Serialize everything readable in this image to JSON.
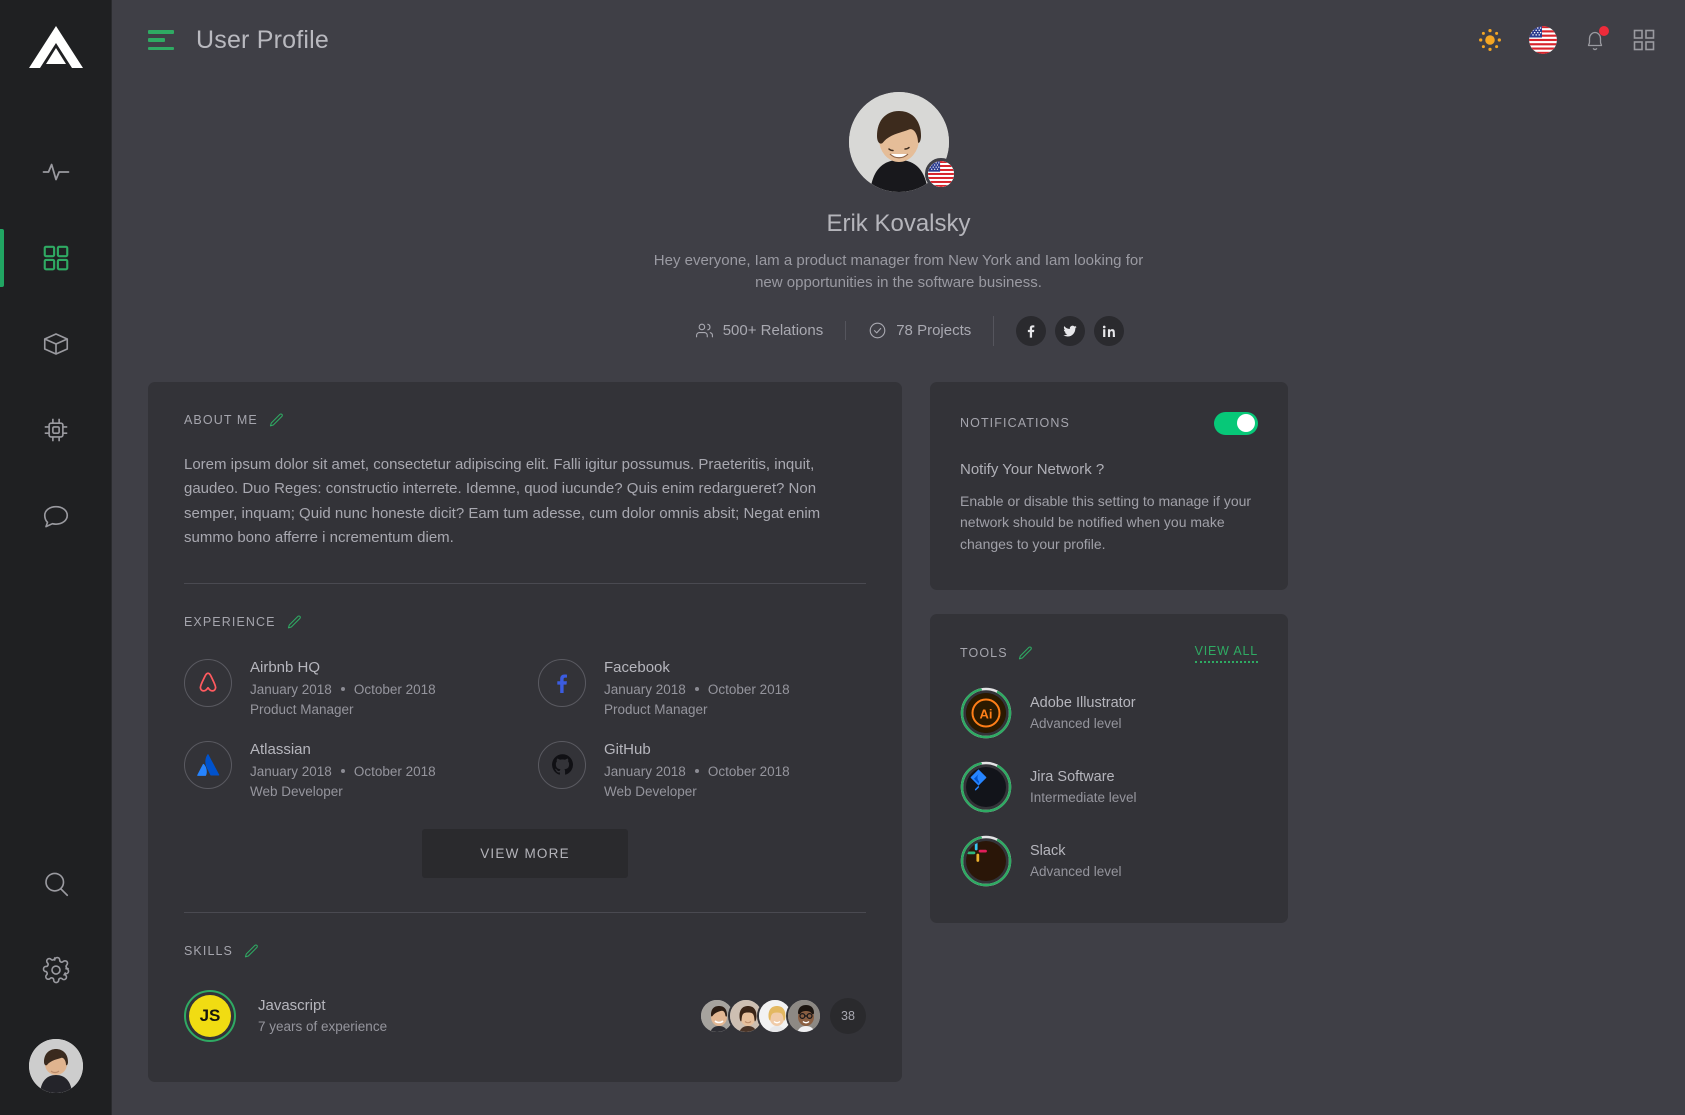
{
  "colors": {
    "accent_green": "#2faa63",
    "toggle_green": "#07c878",
    "page_bg": "#3f3f46",
    "card_bg": "#333338",
    "sidebar_bg": "#1f2022",
    "notif_dot_red": "#ee2b3a",
    "sun_orange": "#f5a623",
    "js_yellow": "#f1dc12"
  },
  "sidebar": {
    "logo_name": "triangle-logo",
    "items": [
      {
        "icon": "activity-icon",
        "name": "sidebar-item-activity",
        "active": false
      },
      {
        "icon": "grid-icon",
        "name": "sidebar-item-dashboard",
        "active": true
      },
      {
        "icon": "box-icon",
        "name": "sidebar-item-packages",
        "active": false
      },
      {
        "icon": "chip-icon",
        "name": "sidebar-item-components",
        "active": false
      },
      {
        "icon": "chat-icon",
        "name": "sidebar-item-messages",
        "active": false
      }
    ],
    "bottom_items": [
      {
        "icon": "search-icon",
        "name": "sidebar-item-search"
      },
      {
        "icon": "gear-icon",
        "name": "sidebar-item-settings"
      }
    ],
    "avatar_name": "sidebar-user-avatar"
  },
  "topbar": {
    "menu_icon": "hamburger-icon",
    "title": "User Profile",
    "actions": [
      {
        "icon": "sun-icon",
        "name": "theme-toggle-button"
      },
      {
        "icon": "flag-us-icon",
        "name": "language-button"
      },
      {
        "icon": "bell-icon",
        "name": "notifications-button",
        "has_badge": true
      },
      {
        "icon": "apps-grid-icon",
        "name": "apps-button"
      }
    ]
  },
  "profile": {
    "avatar_name": "profile-avatar",
    "flag_name": "profile-country-flag",
    "name": "Erik Kovalsky",
    "bio": "Hey everyone,  Iam a product manager from New York and Iam looking for new opportunities in the software business.",
    "stats": [
      {
        "icon": "users-icon",
        "label": "500+ Relations"
      },
      {
        "icon": "check-circle-icon",
        "label": "78 Projects"
      }
    ],
    "socials": [
      {
        "icon": "facebook-icon",
        "name": "social-facebook"
      },
      {
        "icon": "twitter-icon",
        "name": "social-twitter"
      },
      {
        "icon": "linkedin-icon",
        "name": "social-linkedin"
      }
    ]
  },
  "about": {
    "title": "ABOUT ME",
    "edit_icon": "pencil-icon",
    "text": "Lorem ipsum dolor sit amet, consectetur adipiscing elit. Falli igitur possumus. Praeteritis, inquit, gaudeo. Duo Reges: constructio interrete. Idemne, quod iucunde? Quis enim redargueret? Non semper, inquam; Quid nunc honeste dicit? Eam tum adesse, cum dolor omnis absit; Negat enim summo bono afferre i ncrementum diem."
  },
  "experience": {
    "title": "EXPERIENCE",
    "edit_icon": "pencil-icon",
    "items": [
      {
        "company": "Airbnb HQ",
        "logo": "airbnb-icon",
        "start": "January 2018",
        "end": "October 2018",
        "role": "Product Manager"
      },
      {
        "company": "Facebook",
        "logo": "facebook-icon",
        "start": "January 2018",
        "end": "October 2018",
        "role": "Product Manager"
      },
      {
        "company": "Atlassian",
        "logo": "atlassian-icon",
        "start": "January 2018",
        "end": "October 2018",
        "role": "Web Developer"
      },
      {
        "company": "GitHub",
        "logo": "github-icon",
        "start": "January 2018",
        "end": "October 2018",
        "role": "Web Developer"
      }
    ],
    "view_more_label": "VIEW MORE"
  },
  "skills": {
    "title": "SKILLS",
    "edit_icon": "pencil-icon",
    "items": [
      {
        "name": "Javascript",
        "badge_text": "JS",
        "experience": "7 years of experience",
        "people_count": "38"
      }
    ]
  },
  "notifications": {
    "title": "NOTIFICATIONS",
    "toggle_on": true,
    "question": "Notify Your Network ?",
    "description": "Enable or disable this setting to manage if your network should be notified when you make changes to your profile."
  },
  "tools": {
    "title": "TOOLS",
    "edit_icon": "pencil-icon",
    "view_all_label": "VIEW ALL",
    "items": [
      {
        "name": "Adobe Illustrator",
        "level": "Advanced level",
        "icon": "adobe-illustrator-icon",
        "progress": 88
      },
      {
        "name": "Jira Software",
        "level": "Intermediate level",
        "icon": "jira-icon",
        "progress": 88
      },
      {
        "name": "Slack",
        "level": "Advanced level",
        "icon": "slack-icon",
        "progress": 88
      }
    ]
  }
}
